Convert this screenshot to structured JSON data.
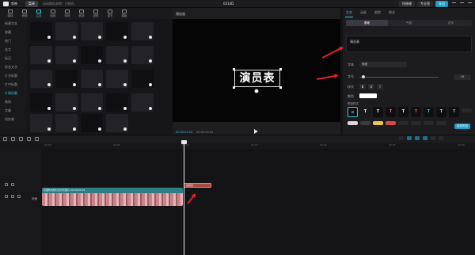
{
  "topbar": {
    "app_name": "剪映",
    "menu_label": "菜单",
    "autosave": "自动保存本地：已保存",
    "project_title": "0314D",
    "shortcut_label": "快捷键",
    "pro_label": "专业版",
    "export_label": "导出"
  },
  "left_tools": [
    {
      "label": "媒体",
      "icon": "media-icon"
    },
    {
      "label": "音频",
      "icon": "audio-icon"
    },
    {
      "label": "文本",
      "icon": "text-icon",
      "active": true
    },
    {
      "label": "贴纸",
      "icon": "sticker-icon"
    },
    {
      "label": "特效",
      "icon": "effects-icon"
    },
    {
      "label": "转场",
      "icon": "transition-icon"
    },
    {
      "label": "滤镜",
      "icon": "filter-icon"
    },
    {
      "label": "调节",
      "icon": "adjust-icon"
    },
    {
      "label": "模板",
      "icon": "template-icon"
    }
  ],
  "categories": [
    {
      "label": "新建文本"
    },
    {
      "label": "收藏"
    },
    {
      "label": "热门"
    },
    {
      "label": "花字"
    },
    {
      "label": "标记"
    },
    {
      "label": "综合文字"
    },
    {
      "label": "片头标题"
    },
    {
      "label": "片中标题"
    },
    {
      "label": "片尾标题",
      "active": true
    },
    {
      "label": "装饰"
    },
    {
      "label": "字幕"
    },
    {
      "label": "科技感"
    }
  ],
  "grid": {
    "section_label": "热门",
    "tiles": [
      "",
      "",
      "",
      "",
      "",
      "",
      "",
      "",
      "",
      "",
      "",
      "",
      "",
      "",
      "",
      "",
      "",
      "",
      "",
      "",
      "",
      "",
      "",
      ""
    ]
  },
  "player": {
    "title": "播放器",
    "canvas_text": "演员表",
    "timecode_current": "00:00:01:25",
    "timecode_total": "00:00:25:02"
  },
  "right_panel": {
    "tabs": [
      "文本",
      "动画",
      "跟踪",
      "朗读"
    ],
    "subtabs": [
      "基础",
      "气泡",
      "花字"
    ],
    "text_value": "演员表",
    "font_label": "字体",
    "font_value": "系统",
    "size_label": "字号",
    "size_value": "15",
    "style_label": "样式",
    "style_buttons": [
      "B",
      "U",
      "I"
    ],
    "color_label": "颜色",
    "color_value": "#ffffff",
    "presets_label": "预设样式",
    "presets": [
      "⊘",
      "T",
      "T",
      "T",
      "T",
      "T",
      "T",
      "T",
      "T"
    ],
    "save_label": "保存预设"
  },
  "timeline": {
    "ruler_ticks": [
      "00:00",
      "00:05",
      "00:10",
      "00:15",
      "00:20",
      "00:25",
      "00:30"
    ],
    "cover_label": "封面",
    "text_clip_label": "演员表",
    "video_clip_label": "花瓣粉色粉红色背景图片  00:00:25:02"
  },
  "colors": {
    "accent": "#39c6d8",
    "export_button": "#1f9ec7",
    "text_clip": "#a84a3e",
    "video_clip_head": "#2c7f86",
    "annotation_arrow": "#e0202a"
  }
}
